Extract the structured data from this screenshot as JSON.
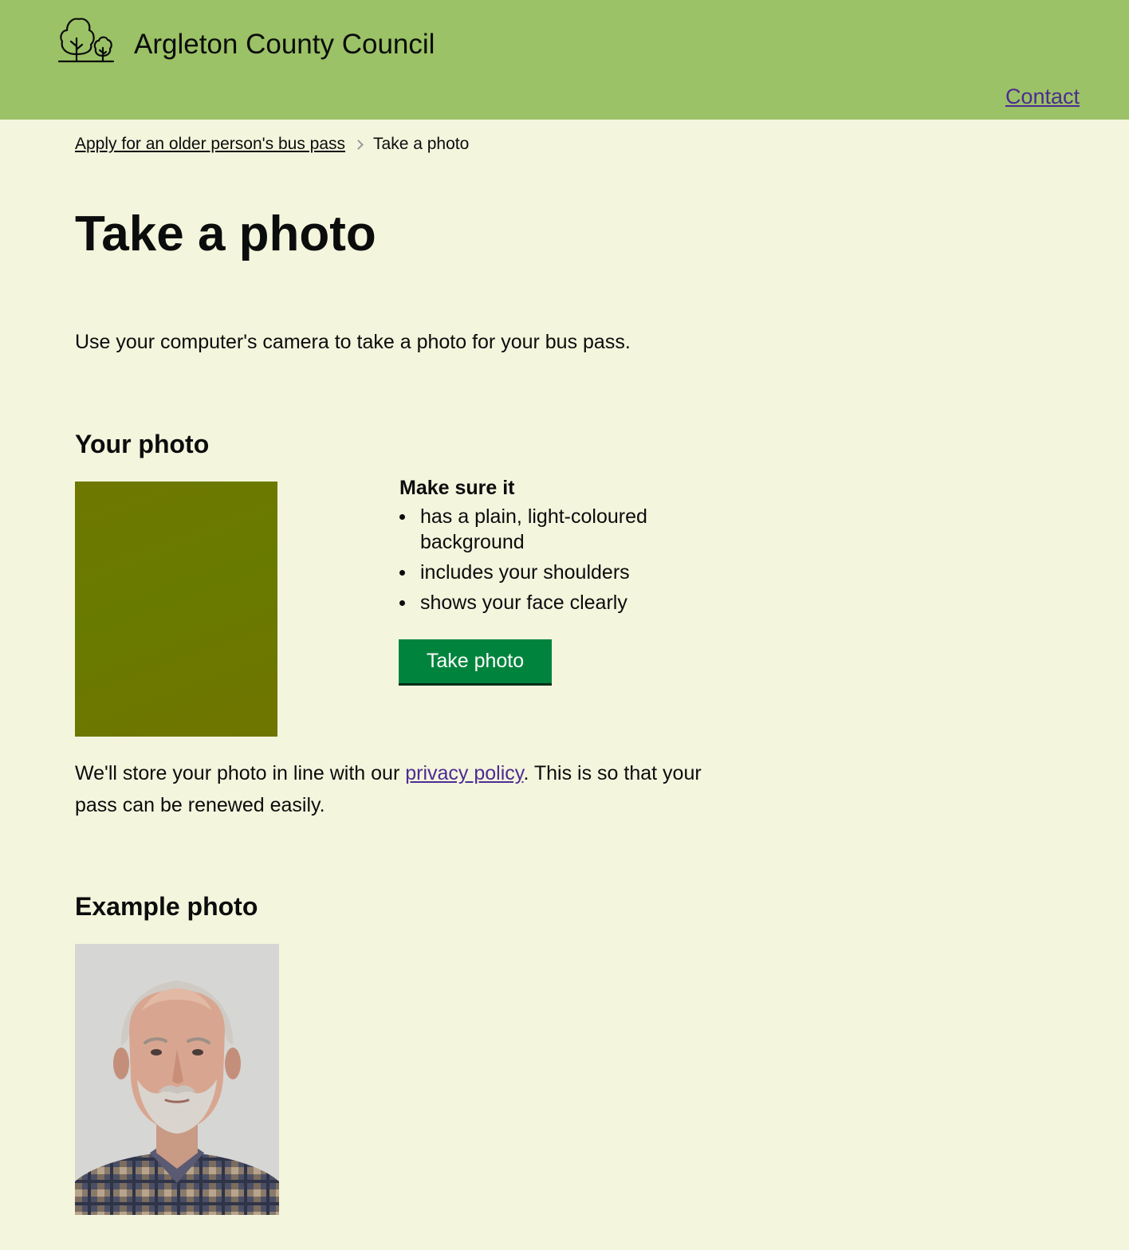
{
  "header": {
    "site_name": "Argleton County Council",
    "contact_label": "Contact",
    "logo_icon": "trees-icon",
    "background_color": "#9bc266"
  },
  "breadcrumbs": {
    "parent_label": "Apply for an older person's bus pass",
    "current_label": "Take a photo"
  },
  "main": {
    "title": "Take a photo",
    "intro": "Use your computer's camera to take a photo for your bus pass.",
    "your_photo_heading": "Your photo",
    "guidance": {
      "title": "Make sure it",
      "items": [
        "has a plain, light-coloured background",
        "includes your shoulders",
        "shows your face clearly"
      ]
    },
    "take_photo_label": "Take photo",
    "privacy": {
      "before": "We'll store your photo in line with our ",
      "link": "privacy policy",
      "after": ". This is so that your pass can be renewed easily."
    },
    "example_photo_heading": "Example photo"
  },
  "colors": {
    "page_background": "#f4f5dd",
    "button": "#00843d",
    "link": "#4c2c92",
    "camera_preview": "#6e7800"
  }
}
